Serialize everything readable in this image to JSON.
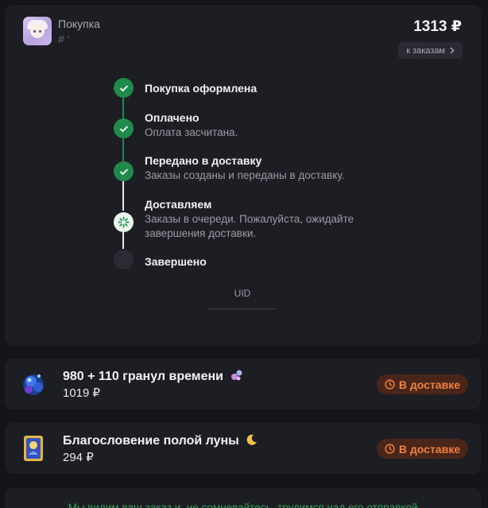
{
  "order": {
    "title": "Покупка",
    "id": "# ‘",
    "total": "1313 ₽",
    "to_orders_label": "к заказам",
    "to_orders_icon": "chevron-right-icon"
  },
  "steps": [
    {
      "title": "Покупка оформлена",
      "desc": "",
      "state": "done"
    },
    {
      "title": "Оплачено",
      "desc": "Оплата засчитана.",
      "state": "done"
    },
    {
      "title": "Передано в доставку",
      "desc": "Заказы созданы и переданы в доставку.",
      "state": "done"
    },
    {
      "title": "Доставляем",
      "desc": "Заказы в очереди. Пожалуйста, ожидайте завершения доставки.",
      "state": "active"
    },
    {
      "title": "Завершено",
      "desc": "",
      "state": "pending"
    }
  ],
  "uid": {
    "label": "UID"
  },
  "items": [
    {
      "name": "980 + 110 гранул времени",
      "price": "1019 ₽",
      "status": "В доставке",
      "icon": "sparkle-icon"
    },
    {
      "name": "Благословение полой луны",
      "price": "294 ₽",
      "status": "В доставке",
      "icon": "moon-icon"
    }
  ],
  "note": {
    "text": "Мы видим ваш заказ и, не сомневайтесь, трудимся над его отправкой"
  },
  "colors": {
    "background": "#14151a",
    "card": "#1d1e24",
    "done": "#1f8a4c",
    "status_text": "#f0813f",
    "status_bg": "#4a2519",
    "note_text": "#2fa35a"
  }
}
